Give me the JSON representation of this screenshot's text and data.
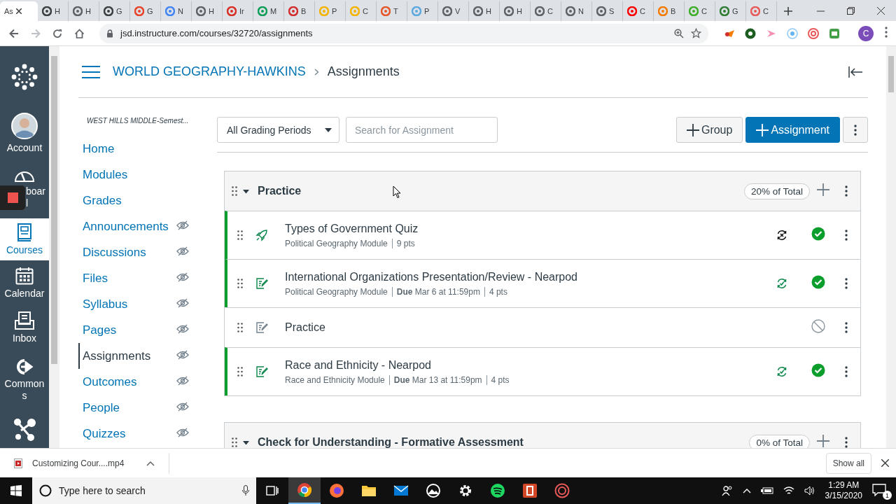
{
  "browser": {
    "tabs": [
      {
        "label": "As",
        "selected": true
      },
      {
        "label": "H",
        "color": "#3c4043",
        "selected": false
      },
      {
        "label": "H",
        "color": "#5f6368",
        "selected": false
      },
      {
        "label": "G",
        "color": "#3c4043",
        "selected": false
      },
      {
        "label": "G",
        "color": "#e8432b",
        "selected": false
      },
      {
        "label": "N",
        "color": "#4285f4",
        "selected": false
      },
      {
        "label": "H",
        "color": "#5f6368",
        "selected": false
      },
      {
        "label": "Ir",
        "color": "#d93025",
        "selected": false
      },
      {
        "label": "M",
        "color": "#0f9d58",
        "selected": false
      },
      {
        "label": "B",
        "color": "#d32f2f",
        "selected": false
      },
      {
        "label": "P",
        "color": "#f4b400",
        "selected": false
      },
      {
        "label": "C",
        "color": "#f4b400",
        "selected": false
      },
      {
        "label": "T",
        "color": "#e8572b",
        "selected": false
      },
      {
        "label": "P",
        "color": "#5ea8e0",
        "selected": false
      },
      {
        "label": "V",
        "color": "#5f6368",
        "selected": false
      },
      {
        "label": "H",
        "color": "#5f6368",
        "selected": false
      },
      {
        "label": "H",
        "color": "#5f6368",
        "selected": false
      },
      {
        "label": "C",
        "color": "#5f6368",
        "selected": false
      },
      {
        "label": "N",
        "color": "#5f6368",
        "selected": false
      },
      {
        "label": "S",
        "color": "#5f6368",
        "selected": false
      },
      {
        "label": "C",
        "color": "#ff0000",
        "selected": false
      },
      {
        "label": "B",
        "color": "#f57c00",
        "selected": false
      },
      {
        "label": "C",
        "color": "#3fae29",
        "selected": false
      },
      {
        "label": "G",
        "color": "#2e7d32",
        "selected": false
      },
      {
        "label": "C",
        "color": "#e85a5a",
        "selected": false
      }
    ],
    "address": "jsd.instructure.com/courses/32720/assignments",
    "profile_initial": "C"
  },
  "global_nav": [
    {
      "kind": "logo",
      "selected": false
    },
    {
      "kind": "account",
      "lines": [
        "Account"
      ],
      "selected": false
    },
    {
      "kind": "dashboard",
      "lines": [
        "boar",
        "l"
      ],
      "selected": false
    },
    {
      "kind": "courses",
      "lines": [
        "Courses"
      ],
      "selected": true
    },
    {
      "kind": "calendar",
      "lines": [
        "Calendar"
      ],
      "selected": false
    },
    {
      "kind": "inbox",
      "lines": [
        "Inbox"
      ],
      "selected": false
    },
    {
      "kind": "commons",
      "lines": [
        "Common",
        "s"
      ],
      "selected": false
    },
    {
      "kind": "network",
      "selected": false
    }
  ],
  "breadcrumb": {
    "course": "WORLD GEOGRAPHY-HAWKINS",
    "page": "Assignments"
  },
  "course_nav": {
    "term": "WEST HILLS MIDDLE-Semest...",
    "items": [
      {
        "label": "Home",
        "hidden": false,
        "selected": false
      },
      {
        "label": "Modules",
        "hidden": false,
        "selected": false
      },
      {
        "label": "Grades",
        "hidden": false,
        "selected": false
      },
      {
        "label": "Announcements",
        "hidden": true,
        "selected": false
      },
      {
        "label": "Discussions",
        "hidden": true,
        "selected": false
      },
      {
        "label": "Files",
        "hidden": true,
        "selected": false
      },
      {
        "label": "Syllabus",
        "hidden": true,
        "selected": false
      },
      {
        "label": "Pages",
        "hidden": true,
        "selected": false
      },
      {
        "label": "Assignments",
        "hidden": true,
        "selected": true
      },
      {
        "label": "Outcomes",
        "hidden": true,
        "selected": false
      },
      {
        "label": "People",
        "hidden": true,
        "selected": false
      },
      {
        "label": "Quizzes",
        "hidden": true,
        "selected": false
      }
    ]
  },
  "toolbar": {
    "grading_period": "All Grading Periods",
    "search": {
      "placeholder": "Search for Assignment"
    },
    "buttons": [
      {
        "kind": "group",
        "label": "Group"
      },
      {
        "kind": "assignment",
        "label": "Assignment"
      }
    ]
  },
  "groups": [
    {
      "title": "Practice",
      "weight": "20% of Total",
      "expanded": true,
      "assignments": [
        {
          "kind": "quiz",
          "title": "Types of Government Quiz",
          "module": "Political Geography Module",
          "points": "9 pts",
          "published": true,
          "synced": false
        },
        {
          "kind": "assignment",
          "title": "International Organizations Presentation/Review - Nearpod",
          "module": "Political Geography Module",
          "due_label": "Due",
          "due": "Mar 6 at 11:59pm",
          "points": "4 pts",
          "published": true,
          "synced": true
        },
        {
          "kind": "assignment",
          "title": "Practice",
          "published": false
        },
        {
          "kind": "assignment",
          "title": "Race and Ethnicity - Nearpod",
          "module": "Race and Ethnicity Module",
          "due_label": "Due",
          "due": "Mar 13 at 11:59pm",
          "points": "4 pts",
          "published": true,
          "synced": true
        }
      ]
    },
    {
      "title": "Check for Understanding - Formative Assessment",
      "weight": "0% of Total",
      "expanded": true
    }
  ],
  "downloads": {
    "file": "Customizing Cour....mp4",
    "show_all": "Show all"
  },
  "taskbar": {
    "search_placeholder": "Type here to search",
    "time": "1:29 AM",
    "date": "3/15/2020",
    "notification_count": "1",
    "apps": [
      {
        "kind": "taskview",
        "selected": false
      },
      {
        "kind": "chrome",
        "selected": true
      },
      {
        "kind": "firefox",
        "selected": false
      },
      {
        "kind": "files",
        "selected": false
      },
      {
        "kind": "mail",
        "selected": false
      },
      {
        "kind": "photos",
        "selected": false
      },
      {
        "kind": "settings",
        "selected": false
      },
      {
        "kind": "spotify",
        "selected": false
      },
      {
        "kind": "powerpoint",
        "selected": false
      },
      {
        "kind": "other",
        "selected": false
      }
    ]
  }
}
